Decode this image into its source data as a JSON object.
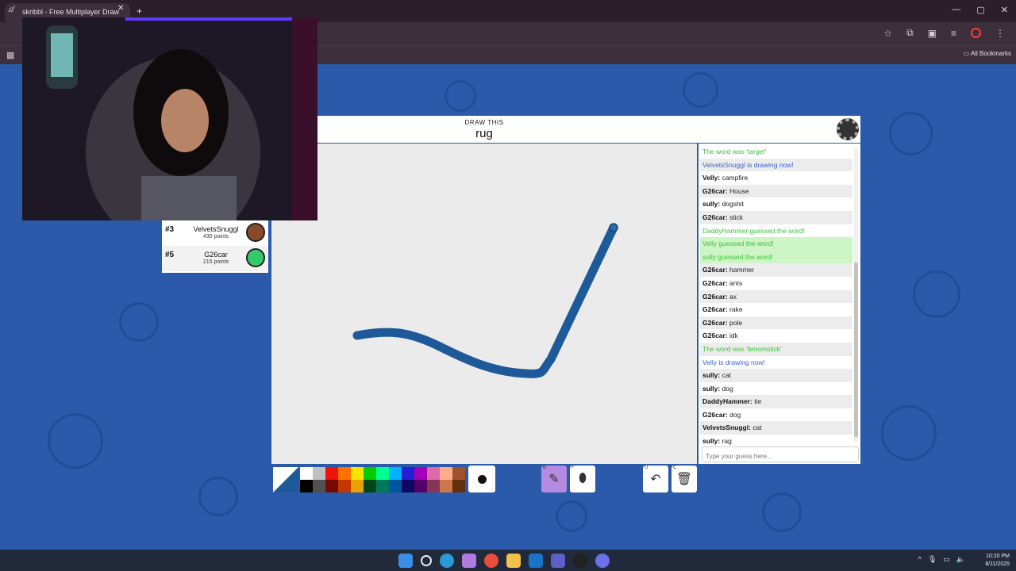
{
  "browser": {
    "tab_title": "skribbl - Free Multiplayer Draw",
    "tab_close": "✕",
    "new_tab": "+",
    "window_controls": [
      "—",
      "▢",
      "✕"
    ],
    "bookmarks_label": "All Bookmarks"
  },
  "game": {
    "draw_label": "DRAW THIS",
    "word": "rug",
    "settings_icon": "gear-icon"
  },
  "players": [
    {
      "rank": "#3",
      "name": "VelvetsSnuggl",
      "points": "430 points",
      "avatar_color": "#8a4a2a"
    },
    {
      "rank": "#5",
      "name": "G26car",
      "points": "215 points",
      "avatar_color": "#35c96a"
    }
  ],
  "chat": {
    "messages": [
      {
        "type": "green",
        "text": "The word was 'target'"
      },
      {
        "type": "blue",
        "text": "VelvetsSnuggl is drawing now!"
      },
      {
        "type": "normal",
        "user": "Velly:",
        "text": " campfire"
      },
      {
        "type": "normal",
        "user": "G26car:",
        "text": " House"
      },
      {
        "type": "normal",
        "user": "sully:",
        "text": " dogshit"
      },
      {
        "type": "normal",
        "user": "G26car:",
        "text": " stick"
      },
      {
        "type": "green",
        "text": "DaddyHammer guessed the word!"
      },
      {
        "type": "green-hl",
        "text": "Velly guessed the word!"
      },
      {
        "type": "green-hl",
        "text": "sully guessed the word!"
      },
      {
        "type": "normal",
        "user": "G26car:",
        "text": " hammer"
      },
      {
        "type": "normal",
        "user": "G26car:",
        "text": " ants"
      },
      {
        "type": "normal",
        "user": "G26car:",
        "text": " ax"
      },
      {
        "type": "normal",
        "user": "G26car:",
        "text": " rake"
      },
      {
        "type": "normal",
        "user": "G26car:",
        "text": " pole"
      },
      {
        "type": "normal",
        "user": "G26car:",
        "text": " idk"
      },
      {
        "type": "green",
        "text": "The word was 'broomstick'"
      },
      {
        "type": "blue",
        "text": "Velly is drawing now!"
      },
      {
        "type": "normal",
        "user": "sully:",
        "text": " cat"
      },
      {
        "type": "normal",
        "user": "sully:",
        "text": " dog"
      },
      {
        "type": "normal",
        "user": "DaddyHammer:",
        "text": " tie"
      },
      {
        "type": "normal",
        "user": "G26car:",
        "text": " dog"
      },
      {
        "type": "normal",
        "user": "VelvetsSnuggl:",
        "text": " cat"
      },
      {
        "type": "normal",
        "user": "sully:",
        "text": " rag"
      }
    ],
    "guess_placeholder": "Type your guess here..."
  },
  "tools": {
    "palette_top": [
      "#ffffff",
      "#c1c1c1",
      "#ef130b",
      "#ff7100",
      "#ffe400",
      "#00cc00",
      "#00ff91",
      "#00b2ff",
      "#231fd3",
      "#a300ba",
      "#df69a7",
      "#ffac8e",
      "#a0522d"
    ],
    "palette_bottom": [
      "#000000",
      "#505050",
      "#740b07",
      "#c23800",
      "#e8a200",
      "#004619",
      "#00785d",
      "#00569e",
      "#0e0865",
      "#550069",
      "#873554",
      "#cc774d",
      "#63300d"
    ],
    "current_color": "#1e5a9a",
    "brush_key": "B",
    "fill_key": "F",
    "undo_key": "U",
    "clear_key": "C"
  },
  "taskbar": {
    "time": "10:20 PM",
    "date": "8/11/2025"
  }
}
